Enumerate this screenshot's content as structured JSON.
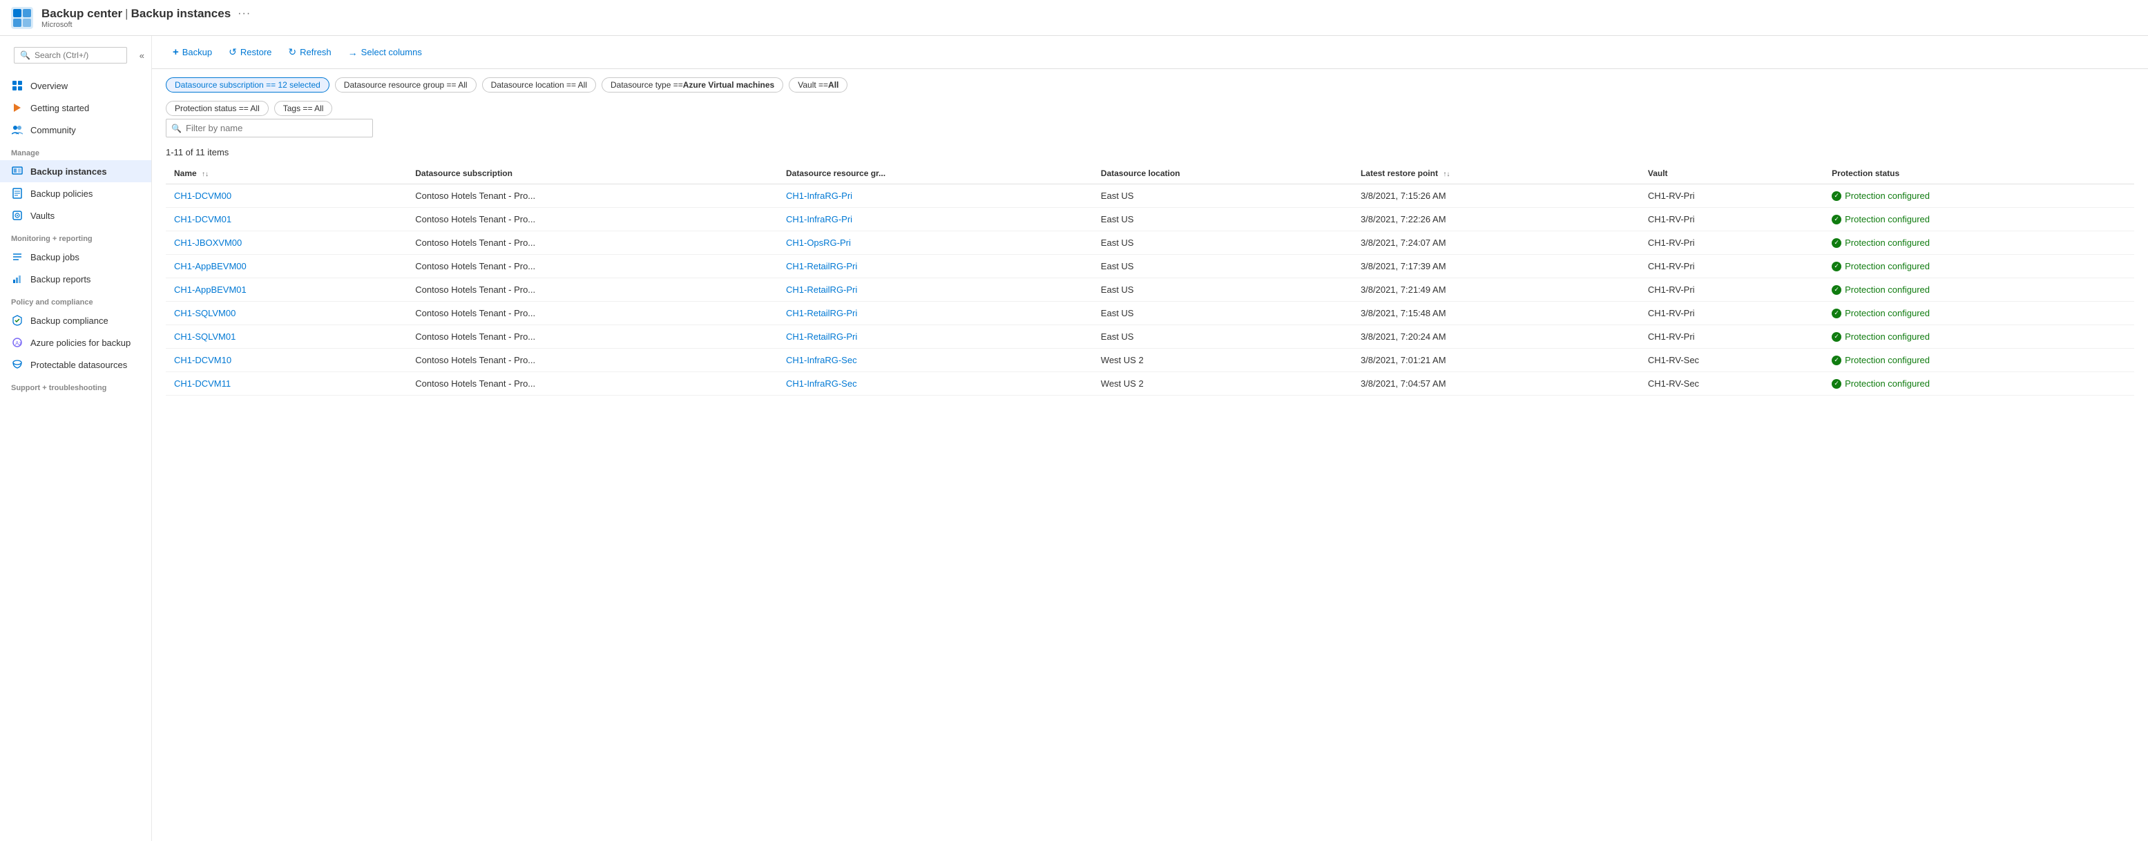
{
  "header": {
    "app_title": "Backup center",
    "separator": "|",
    "page_title": "Backup instances",
    "subtitle": "Microsoft",
    "more_icon": "···"
  },
  "sidebar": {
    "search_placeholder": "Search (Ctrl+/)",
    "collapse_label": "«",
    "nav_items": [
      {
        "id": "overview",
        "label": "Overview",
        "icon": "grid"
      },
      {
        "id": "getting-started",
        "label": "Getting started",
        "icon": "lightning"
      },
      {
        "id": "community",
        "label": "Community",
        "icon": "people"
      }
    ],
    "sections": [
      {
        "label": "Manage",
        "items": [
          {
            "id": "backup-instances",
            "label": "Backup instances",
            "icon": "instances",
            "active": true
          },
          {
            "id": "backup-policies",
            "label": "Backup policies",
            "icon": "policies"
          },
          {
            "id": "vaults",
            "label": "Vaults",
            "icon": "vaults"
          }
        ]
      },
      {
        "label": "Monitoring + reporting",
        "items": [
          {
            "id": "backup-jobs",
            "label": "Backup jobs",
            "icon": "jobs"
          },
          {
            "id": "backup-reports",
            "label": "Backup reports",
            "icon": "reports"
          }
        ]
      },
      {
        "label": "Policy and compliance",
        "items": [
          {
            "id": "backup-compliance",
            "label": "Backup compliance",
            "icon": "compliance"
          },
          {
            "id": "azure-policies",
            "label": "Azure policies for backup",
            "icon": "azure-policy"
          },
          {
            "id": "protectable-datasources",
            "label": "Protectable datasources",
            "icon": "datasources"
          }
        ]
      },
      {
        "label": "Support + troubleshooting",
        "items": []
      }
    ]
  },
  "toolbar": {
    "buttons": [
      {
        "id": "backup",
        "label": "Backup",
        "icon": "plus"
      },
      {
        "id": "restore",
        "label": "Restore",
        "icon": "restore"
      },
      {
        "id": "refresh",
        "label": "Refresh",
        "icon": "refresh"
      },
      {
        "id": "select-columns",
        "label": "Select columns",
        "icon": "arrow-right"
      }
    ]
  },
  "filters": {
    "chips": [
      {
        "id": "datasource-subscription",
        "label": "Datasource subscription == 12 selected",
        "active": true
      },
      {
        "id": "datasource-resource-group",
        "label": "Datasource resource group == All",
        "active": false
      },
      {
        "id": "datasource-location",
        "label": "Datasource location == All",
        "active": false
      },
      {
        "id": "datasource-type",
        "label": "Datasource type == Azure Virtual machines",
        "active": false
      },
      {
        "id": "vault",
        "label": "Vault == All",
        "active": false
      },
      {
        "id": "protection-status",
        "label": "Protection status == All",
        "active": false
      },
      {
        "id": "tags",
        "label": "Tags == All",
        "active": false
      }
    ]
  },
  "table": {
    "filter_placeholder": "Filter by name",
    "items_count": "1-11 of 11 items",
    "columns": [
      {
        "id": "name",
        "label": "Name",
        "sortable": true
      },
      {
        "id": "datasource-subscription",
        "label": "Datasource subscription",
        "sortable": false
      },
      {
        "id": "datasource-resource-group",
        "label": "Datasource resource gr...",
        "sortable": false
      },
      {
        "id": "datasource-location",
        "label": "Datasource location",
        "sortable": false
      },
      {
        "id": "latest-restore-point",
        "label": "Latest restore point",
        "sortable": true
      },
      {
        "id": "vault",
        "label": "Vault",
        "sortable": false
      },
      {
        "id": "protection-status",
        "label": "Protection status",
        "sortable": false
      }
    ],
    "rows": [
      {
        "name": "CH1-DCVM00",
        "subscription": "Contoso Hotels Tenant - Pro...",
        "resource_group": "CH1-InfraRG-Pri",
        "location": "East US",
        "restore_point": "3/8/2021, 7:15:26 AM",
        "vault": "CH1-RV-Pri",
        "protection_status": "Protection configured"
      },
      {
        "name": "CH1-DCVM01",
        "subscription": "Contoso Hotels Tenant - Pro...",
        "resource_group": "CH1-InfraRG-Pri",
        "location": "East US",
        "restore_point": "3/8/2021, 7:22:26 AM",
        "vault": "CH1-RV-Pri",
        "protection_status": "Protection configured"
      },
      {
        "name": "CH1-JBOXVM00",
        "subscription": "Contoso Hotels Tenant - Pro...",
        "resource_group": "CH1-OpsRG-Pri",
        "location": "East US",
        "restore_point": "3/8/2021, 7:24:07 AM",
        "vault": "CH1-RV-Pri",
        "protection_status": "Protection configured"
      },
      {
        "name": "CH1-AppBEVM00",
        "subscription": "Contoso Hotels Tenant - Pro...",
        "resource_group": "CH1-RetailRG-Pri",
        "location": "East US",
        "restore_point": "3/8/2021, 7:17:39 AM",
        "vault": "CH1-RV-Pri",
        "protection_status": "Protection configured"
      },
      {
        "name": "CH1-AppBEVM01",
        "subscription": "Contoso Hotels Tenant - Pro...",
        "resource_group": "CH1-RetailRG-Pri",
        "location": "East US",
        "restore_point": "3/8/2021, 7:21:49 AM",
        "vault": "CH1-RV-Pri",
        "protection_status": "Protection configured"
      },
      {
        "name": "CH1-SQLVM00",
        "subscription": "Contoso Hotels Tenant - Pro...",
        "resource_group": "CH1-RetailRG-Pri",
        "location": "East US",
        "restore_point": "3/8/2021, 7:15:48 AM",
        "vault": "CH1-RV-Pri",
        "protection_status": "Protection configured"
      },
      {
        "name": "CH1-SQLVM01",
        "subscription": "Contoso Hotels Tenant - Pro...",
        "resource_group": "CH1-RetailRG-Pri",
        "location": "East US",
        "restore_point": "3/8/2021, 7:20:24 AM",
        "vault": "CH1-RV-Pri",
        "protection_status": "Protection configured"
      },
      {
        "name": "CH1-DCVM10",
        "subscription": "Contoso Hotels Tenant - Pro...",
        "resource_group": "CH1-InfraRG-Sec",
        "location": "West US 2",
        "restore_point": "3/8/2021, 7:01:21 AM",
        "vault": "CH1-RV-Sec",
        "protection_status": "Protection configured"
      },
      {
        "name": "CH1-DCVM11",
        "subscription": "Contoso Hotels Tenant - Pro...",
        "resource_group": "CH1-InfraRG-Sec",
        "location": "West US 2",
        "restore_point": "3/8/2021, 7:04:57 AM",
        "vault": "CH1-RV-Sec",
        "protection_status": "Protection configured"
      }
    ]
  }
}
